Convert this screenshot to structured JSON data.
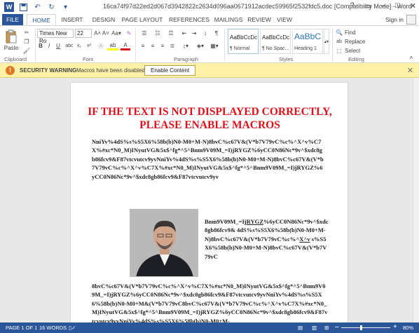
{
  "window": {
    "title": "16ca74f97d22ed2d067d3942822c2634d096aa0671912acdec59965f2532fdc5.doc [Compatibility Mode] - Word",
    "help": "?",
    "restore": "▭",
    "minimize": "–",
    "maximize": "□",
    "close": "✕"
  },
  "tabs": [
    "FILE",
    "HOME",
    "INSERT",
    "DESIGN",
    "PAGE LAYOUT",
    "REFERENCES",
    "MAILINGS",
    "REVIEW",
    "VIEW"
  ],
  "signin": "Sign in",
  "ribbon": {
    "paste_label": "Paste",
    "font_name": "Times New Ro",
    "font_size": "22",
    "groups": [
      "Clipboard",
      "Font",
      "Paragraph",
      "Styles",
      "Editing"
    ],
    "styles": [
      {
        "preview": "AaBbCcDc",
        "name": "¶ Normal"
      },
      {
        "preview": "AaBbCcDc",
        "name": "¶ No Spac..."
      },
      {
        "preview": "AaBbC",
        "name": "Heading 1"
      }
    ],
    "find": "Find",
    "replace": "Replace",
    "select": "Select"
  },
  "security": {
    "title": "SECURITY WARNING",
    "message": "Macros have been disabled.",
    "button": "Enable Content"
  },
  "document": {
    "heading": "IF THE TEXT IS NOT DISPLAYED CORRECTLY, PLEASE ENABLE MACROS",
    "para1": "NniYv%4dS%s%S5X6%58b(b)N0-M0+M-N)8bvC%c67V&(V*b7V79vC%c%^X^v%C7X%#xc*N0_M)INyutVG&5x$^fg*^5^Bnm9V09M_=I)jRYGZ%6yCC0N86Nc*9v^$xdc8gb86fcv9&F87vtcvutcv9yvNniYv%4dS%s%S5X6%58b(b)N0-M0+M-N)8bvC%c67V&(V*b7V79vC%c%^X^v%C7X%#xc*N0_M)INyutVG&5x$^fg*^5^Bnm9V09M_=I)jRYGZ%6yCC0N86Nc*9v^$xdc8gb86fcv9&F87vtcvutcv9yv",
    "para2_a": "Bnm9V09M_=I",
    "para2_u1": "jRYGZ",
    "para2_b": "%6yCC0N86Nc*9v^$xdc8gb86fcv9& 4dS%s%S5X6%58b(b)N0-M0+M-N)8bvC%c67V&(V*b7V79vC%c%^",
    "para2_u2": "X^v",
    "para2_c": " s%S5X6%58b(b)N0-M0+M-N)8bvC%c67V&(V*b7V79vC",
    "para3": "8bvC%c67V&(V*b7V79vC%c%^X^v%C7X%#xc*N0_M)INyutVG&5x$^fg*^5^Bnm9V09M_=I)jRYGZ%6yCC0N86Nc*9v^$xdc8gb86fcv9&F87vtcvutcv9yvNniYv%4dS%s%S5X6%58b(b)N0-M0+M&(V*b7V79vC8bvC%c67V&(V*b7V79vC%c%^X^v%C7X%#xc*N0_M)INyutVG&5x$^fg*^5^Bnm9V09M_=I)jRYGZ%6yCC0N86Nc*9v^$xdc8gb86fcv9&F87vtcvutcv9yvNniYv%4dS%s%S5X6%58b(b)N0-M0+M-"
  },
  "status": {
    "page": "PAGE 1 OF 1",
    "words": "16 WORDS",
    "zoom": "80%"
  },
  "colors": {
    "accent": "#2b579a",
    "heading_red": "#e0101a",
    "warning_bar": "#fff1a8"
  }
}
